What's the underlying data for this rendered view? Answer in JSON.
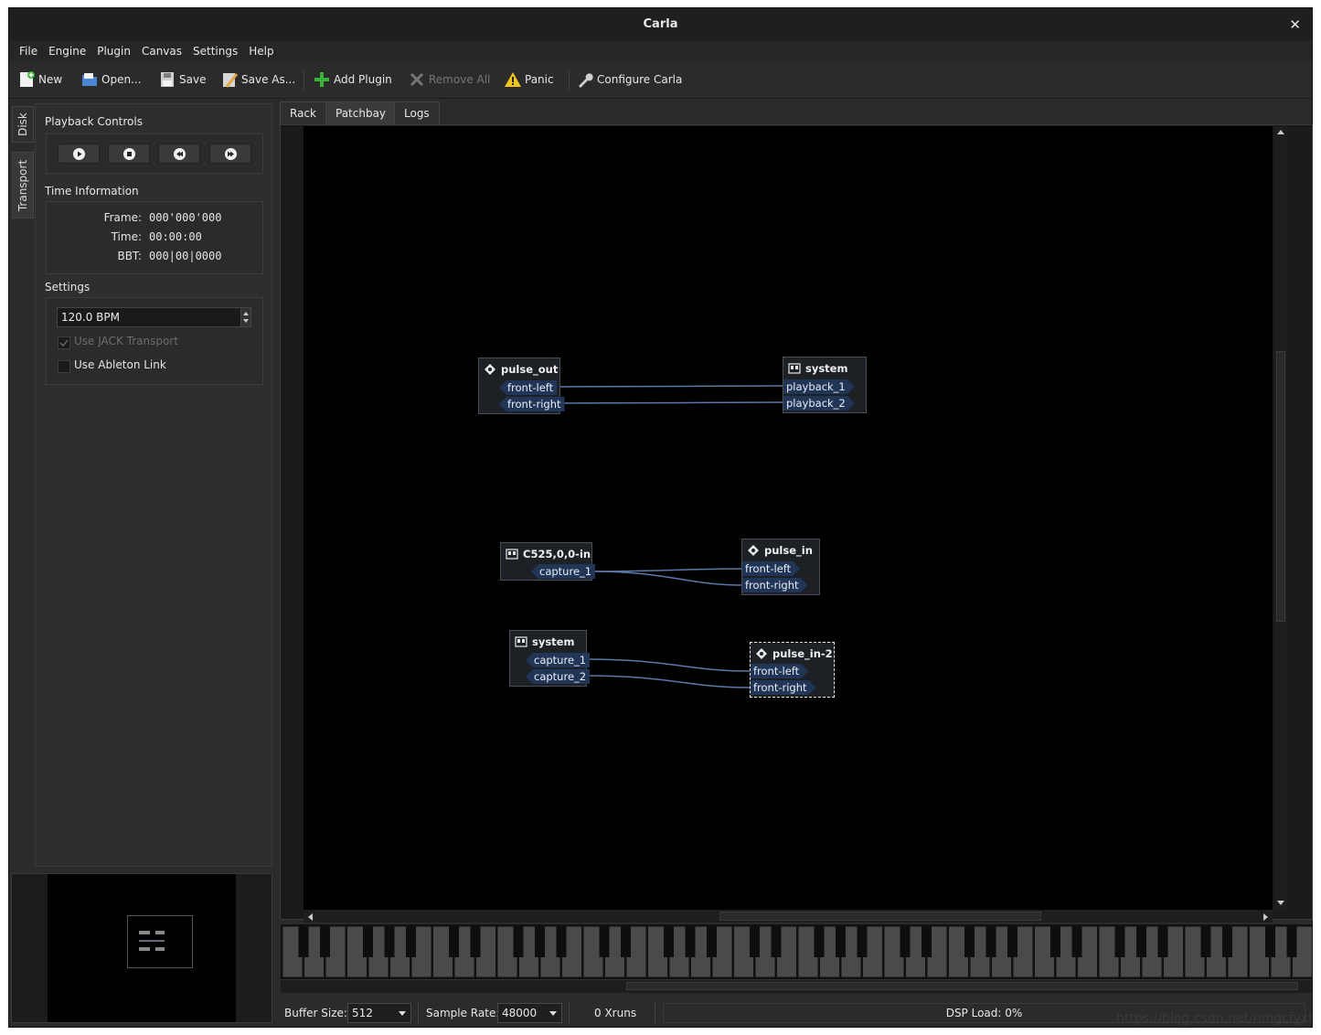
{
  "window": {
    "title": "Carla"
  },
  "menu": [
    "File",
    "Engine",
    "Plugin",
    "Canvas",
    "Settings",
    "Help"
  ],
  "toolbar": {
    "new": "New",
    "open": "Open...",
    "save": "Save",
    "save_as": "Save As...",
    "add_plugin": "Add Plugin",
    "remove_all": "Remove All",
    "panic": "Panic",
    "configure": "Configure Carla"
  },
  "side_tabs": {
    "disk": "Disk",
    "transport": "Transport"
  },
  "transport": {
    "playback_title": "Playback Controls",
    "time_title": "Time Information",
    "frame_label": "Frame:",
    "frame_value": "000'000'000",
    "time_label": "Time:",
    "time_value": "00:00:00",
    "bbt_label": "BBT:",
    "bbt_value": "000|00|0000",
    "settings_title": "Settings",
    "bpm": "120.0 BPM",
    "use_jack_transport": "Use JACK Transport",
    "use_ableton_link": "Use Ableton Link"
  },
  "tabs": [
    "Rack",
    "Patchbay",
    "Logs"
  ],
  "patchbay": {
    "groups": [
      {
        "name": "pulse_out",
        "ports": [
          "front-left",
          "front-right"
        ]
      },
      {
        "name": "system",
        "ports": [
          "playback_1",
          "playback_2"
        ]
      },
      {
        "name": "C525,0,0-in",
        "ports": [
          "capture_1"
        ]
      },
      {
        "name": "pulse_in",
        "ports": [
          "front-left",
          "front-right"
        ]
      },
      {
        "name": "system",
        "ports": [
          "capture_1",
          "capture_2"
        ]
      },
      {
        "name": "pulse_in-2",
        "ports": [
          "front-left",
          "front-right"
        ]
      }
    ]
  },
  "status": {
    "buffer_label": "Buffer Size:",
    "buffer_value": "512",
    "rate_label": "Sample Rate:",
    "rate_value": "48000",
    "xruns": "0 Xruns",
    "dsp": "DSP Load: 0%"
  },
  "watermark": "https://blog.csdn.net/nmgcfyxl"
}
